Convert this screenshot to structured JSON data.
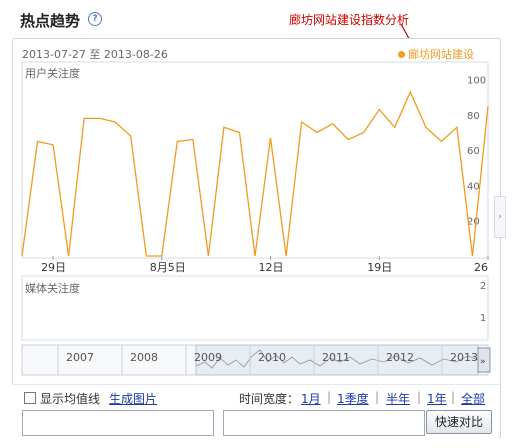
{
  "header": {
    "title": "热点趋势",
    "help_icon": "question-circle-icon",
    "annotation": "廊坊网站建设指数分析"
  },
  "chart": {
    "date_range": "2013-07-27 至 2013-08-26",
    "legend": "廊坊网站建设",
    "color": "#f29b1f",
    "upper_panel_label": "用户关注度",
    "lower_panel_label": "媒体关注度",
    "lower_ticks": [
      "2",
      "1"
    ]
  },
  "chart_data": {
    "type": "line",
    "title": "",
    "ylabel": "用户关注度",
    "x": [
      "2013-07-27",
      "2013-07-28",
      "2013-07-29",
      "2013-07-30",
      "2013-07-31",
      "2013-08-01",
      "2013-08-02",
      "2013-08-03",
      "2013-08-04",
      "2013-08-05",
      "2013-08-06",
      "2013-08-07",
      "2013-08-08",
      "2013-08-09",
      "2013-08-10",
      "2013-08-11",
      "2013-08-12",
      "2013-08-13",
      "2013-08-14",
      "2013-08-15",
      "2013-08-16",
      "2013-08-17",
      "2013-08-18",
      "2013-08-19",
      "2013-08-20",
      "2013-08-21",
      "2013-08-22",
      "2013-08-23",
      "2013-08-24",
      "2013-08-25",
      "2013-08-26"
    ],
    "x_tick_labels": [
      "29日",
      "8月5日",
      "12日",
      "19日",
      "26"
    ],
    "y_ticks": [
      20,
      40,
      60,
      80,
      100
    ],
    "ylim": [
      0,
      110
    ],
    "series": [
      {
        "name": "廊坊网站建设",
        "values": [
          0,
          65,
          63,
          0,
          78,
          78,
          76,
          68,
          0,
          0,
          65,
          66,
          0,
          73,
          70,
          0,
          67,
          0,
          76,
          70,
          75,
          66,
          70,
          83,
          73,
          93,
          73,
          65,
          73,
          0,
          85
        ]
      }
    ],
    "grid": false
  },
  "timeline": {
    "years": [
      "2007",
      "2008",
      "2009",
      "2010",
      "2011",
      "2012",
      "2013"
    ]
  },
  "controls": {
    "show_avg_label": "显示均值线",
    "gen_image_label": "生成图片",
    "range_label": "时间宽度：",
    "ranges": [
      "1月",
      "1季度",
      "半年",
      "1年",
      "全部"
    ],
    "input1_value": "",
    "input2_value": "",
    "compare_button": "快速对比"
  }
}
